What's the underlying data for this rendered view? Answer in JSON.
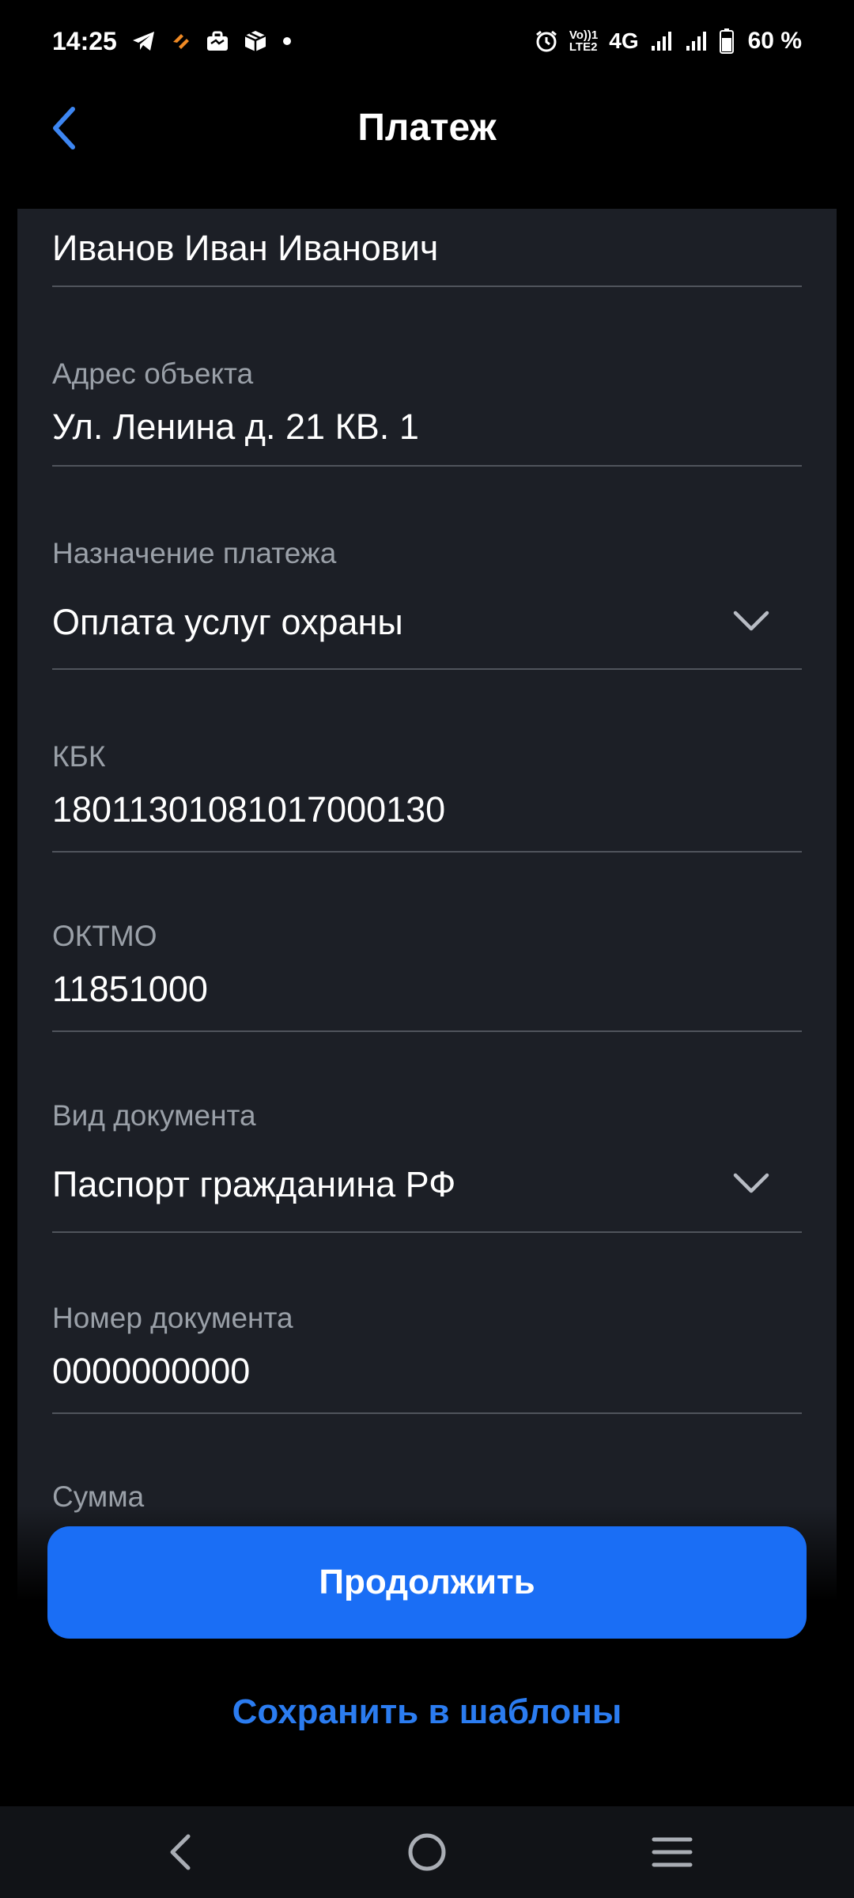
{
  "status_bar": {
    "time": "14:25",
    "network": "4G",
    "volte_top": "Vo))1",
    "volte_bottom": "LTE2",
    "battery": "60 %",
    "icons": [
      "telegram-icon",
      "app-notification-icon",
      "briefcase-icon",
      "package-icon",
      "dot-icon",
      "alarm-icon",
      "volte-icon",
      "signal-icon",
      "signal-icon",
      "battery-icon"
    ]
  },
  "header": {
    "title": "Платеж"
  },
  "form": {
    "fields": [
      {
        "label": "",
        "value": "Иванов Иван Иванович"
      },
      {
        "label": "Адрес объекта",
        "value": "Ул. Ленина д. 21 КВ. 1"
      },
      {
        "label": "Назначение платежа",
        "value": "Оплата услуг охраны"
      },
      {
        "label": "КБК",
        "value": "18011301081017000130"
      },
      {
        "label": "ОКТМО",
        "value": "11851000"
      },
      {
        "label": "Вид документа",
        "value": "Паспорт гражданина РФ"
      },
      {
        "label": "Номер документа",
        "value": "0000000000"
      },
      {
        "label": "Сумма",
        "value": ""
      }
    ]
  },
  "actions": {
    "continue_label": "Продолжить",
    "save_template_label": "Сохранить в шаблоны"
  },
  "colors": {
    "accent": "#1a6ef5",
    "link": "#2b7cf0",
    "card": "#1c1f26",
    "label": "#9aa0a8"
  }
}
